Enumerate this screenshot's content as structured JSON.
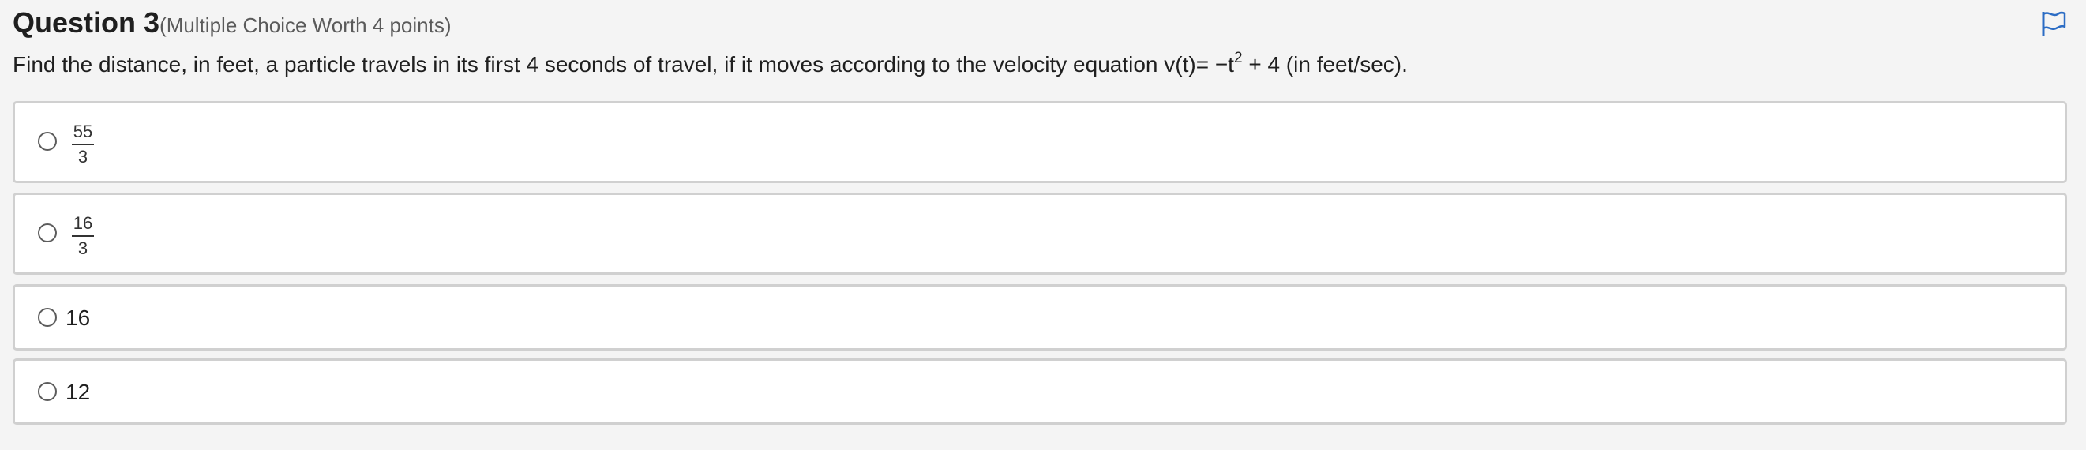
{
  "question": {
    "title": "Question 3",
    "subtitle": "(Multiple Choice Worth 4 points)",
    "prompt_before_sup": "Find the distance, in feet, a particle travels in its first 4 seconds of travel, if it moves according to the velocity equation v(t)= −t",
    "prompt_sup": "2",
    "prompt_after_sup": " + 4 (in feet/sec).",
    "flag_icon": "flag-icon"
  },
  "options": [
    {
      "type": "fraction",
      "numerator": "55",
      "denominator": "3"
    },
    {
      "type": "fraction",
      "numerator": "16",
      "denominator": "3"
    },
    {
      "type": "text",
      "value": "16"
    },
    {
      "type": "text",
      "value": "12"
    }
  ],
  "colors": {
    "background": "#f4f4f4",
    "flag": "#2b6cc4",
    "option_border": "#d0d0d0"
  }
}
